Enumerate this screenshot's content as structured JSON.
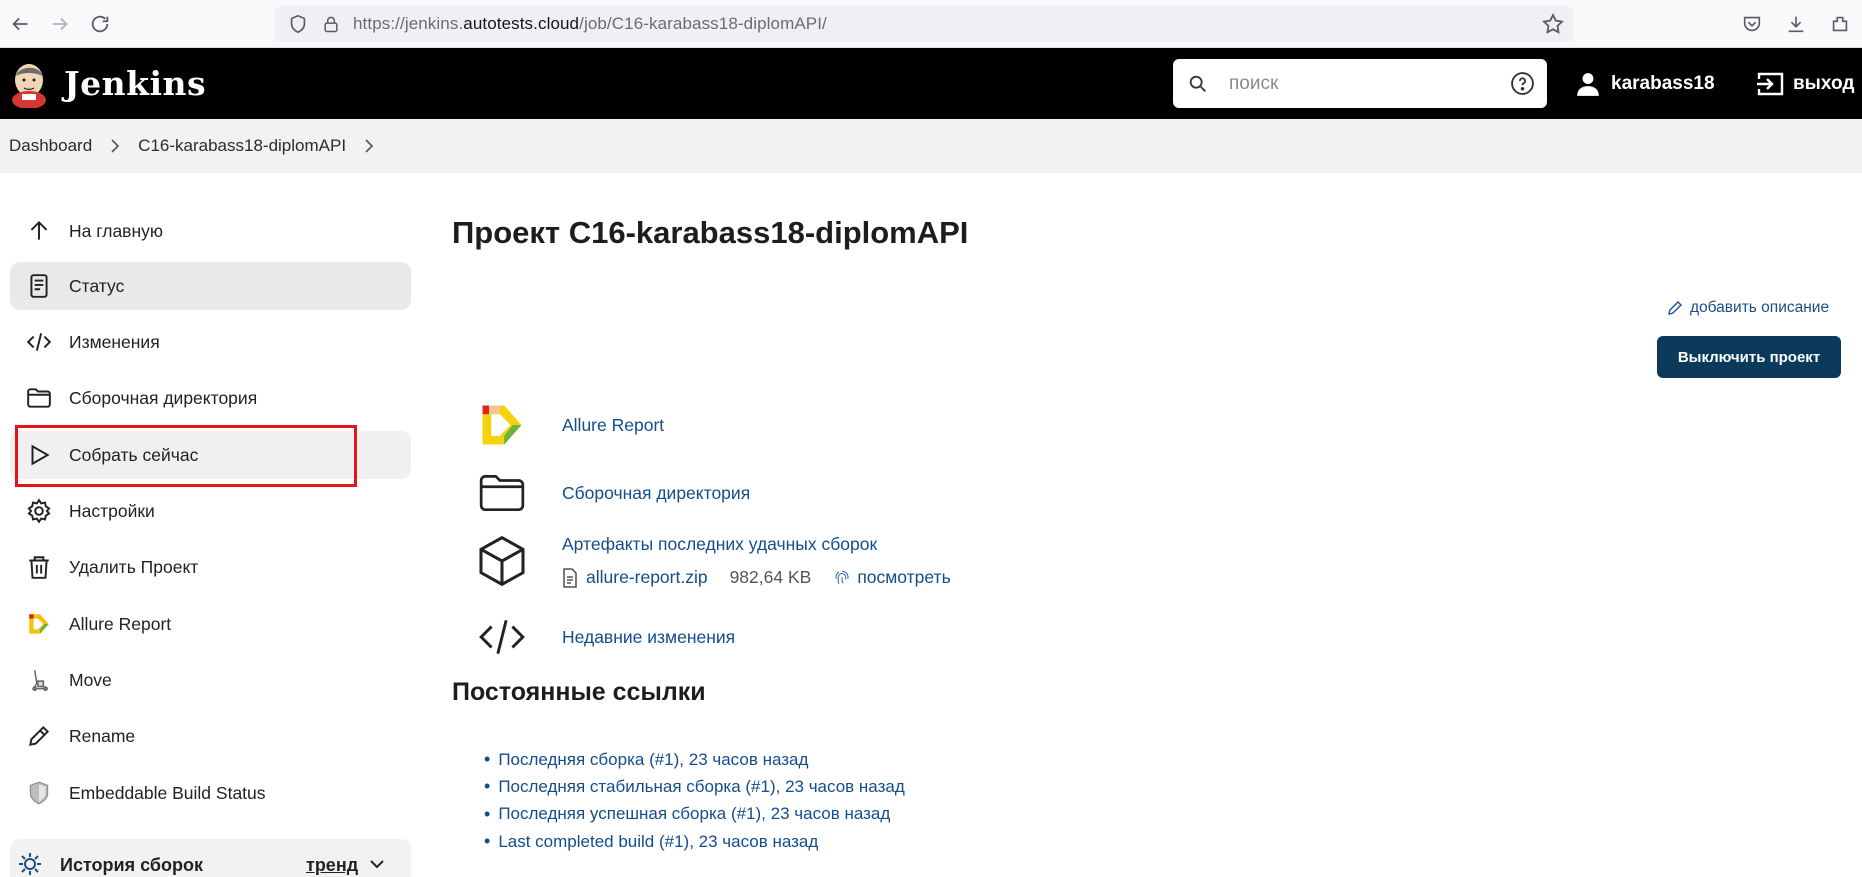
{
  "browser": {
    "url_prefix": "https://jenkins.",
    "url_host": "autotests.cloud",
    "url_path": "/job/C16-karabass18-diplomAPI/"
  },
  "header": {
    "brand": "Jenkins",
    "search_placeholder": "поиск",
    "username": "karabass18",
    "logout_label": "выход"
  },
  "breadcrumb": {
    "items": [
      "Dashboard",
      "C16-karabass18-diplomAPI"
    ]
  },
  "sidebar": {
    "items": [
      {
        "label": "На главную",
        "icon": "arrow-up-icon"
      },
      {
        "label": "Статус",
        "icon": "document-icon"
      },
      {
        "label": "Изменения",
        "icon": "code-icon"
      },
      {
        "label": "Сборочная директория",
        "icon": "folder-icon"
      },
      {
        "label": "Собрать сейчас",
        "icon": "play-icon"
      },
      {
        "label": "Настройки",
        "icon": "gear-icon"
      },
      {
        "label": "Удалить Проект",
        "icon": "trash-icon"
      },
      {
        "label": "Allure Report",
        "icon": "allure-icon"
      },
      {
        "label": "Move",
        "icon": "move-icon"
      },
      {
        "label": "Rename",
        "icon": "pencil-icon"
      },
      {
        "label": "Embeddable Build Status",
        "icon": "shield-badge-icon"
      }
    ],
    "history": {
      "label": "История сборок",
      "trend": "тренд"
    }
  },
  "main": {
    "title": "Проект C16-karabass18-diplomAPI",
    "add_description": "добавить описание",
    "disable_button": "Выключить проект",
    "links": {
      "allure": "Allure Report",
      "workspace": "Сборочная директория",
      "artifacts": "Артефакты последних удачных сборок",
      "recent_changes": "Недавние изменения"
    },
    "artifact": {
      "file": "allure-report.zip",
      "size": "982,64 KB",
      "view": "посмотреть"
    },
    "permalinks_title": "Постоянные ссылки",
    "permalinks": [
      "Последняя сборка (#1), 23 часов назад",
      "Последняя стабильная сборка (#1), 23 часов назад",
      "Последняя успешная сборка (#1), 23 часов назад",
      "Last completed build (#1), 23 часов назад"
    ]
  },
  "colors": {
    "header_bg": "#000000",
    "link": "#144d8c",
    "primary_button": "#0b3a5c",
    "highlight": "#e4141b",
    "active_item": "#e9e9ea"
  }
}
